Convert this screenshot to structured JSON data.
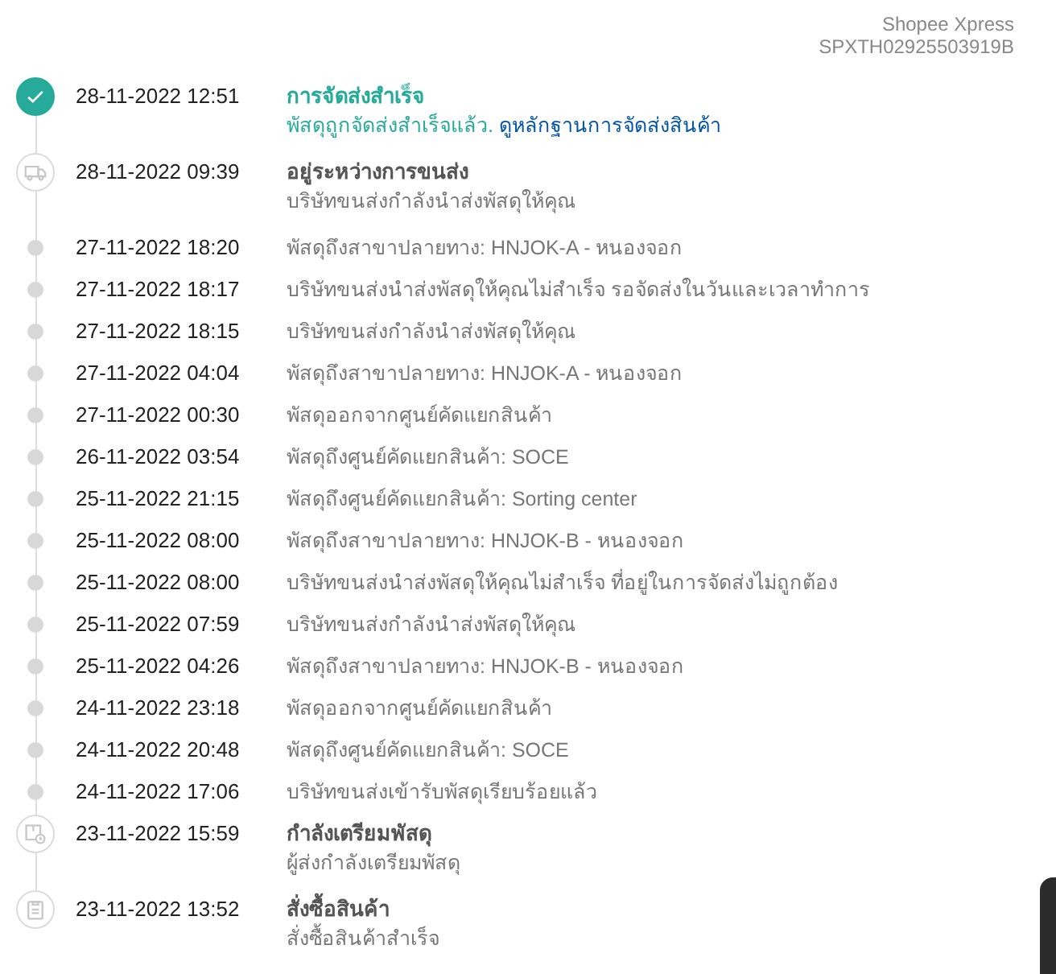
{
  "header": {
    "carrier": "Shopee Xpress",
    "tracking_number": "SPXTH02925503919B"
  },
  "events": [
    {
      "kind": "delivered",
      "active": true,
      "time": "28-11-2022 12:51",
      "title": "การจัดส่งสำเร็จ",
      "description": "พัสดุถูกจัดส่งสำเร็จแล้ว.",
      "link": "ดูหลักฐานการจัดส่งสินค้า"
    },
    {
      "kind": "shipping",
      "active": false,
      "time": "28-11-2022 09:39",
      "title": "อยู่ระหว่างการขนส่ง",
      "description": "บริษัทขนส่งกำลังนำส่งพัสดุให้คุณ"
    },
    {
      "kind": "minor",
      "time": "27-11-2022 18:20",
      "description": "พัสดุถึงสาขาปลายทาง: HNJOK-A - หนองจอก"
    },
    {
      "kind": "minor",
      "time": "27-11-2022 18:17",
      "description": "บริษัทขนส่งนำส่งพัสดุให้คุณไม่สำเร็จ รอจัดส่งในวันและเวลาทำการ"
    },
    {
      "kind": "minor",
      "time": "27-11-2022 18:15",
      "description": "บริษัทขนส่งกำลังนำส่งพัสดุให้คุณ"
    },
    {
      "kind": "minor",
      "time": "27-11-2022 04:04",
      "description": "พัสดุถึงสาขาปลายทาง: HNJOK-A - หนองจอก"
    },
    {
      "kind": "minor",
      "time": "27-11-2022 00:30",
      "description": "พัสดุออกจากศูนย์คัดแยกสินค้า"
    },
    {
      "kind": "minor",
      "time": "26-11-2022 03:54",
      "description": "พัสดุถึงศูนย์คัดแยกสินค้า: SOCE"
    },
    {
      "kind": "minor",
      "time": "25-11-2022 21:15",
      "description": "พัสดุถึงศูนย์คัดแยกสินค้า: Sorting center"
    },
    {
      "kind": "minor",
      "time": "25-11-2022 08:00",
      "description": "พัสดุถึงสาขาปลายทาง: HNJOK-B - หนองจอก"
    },
    {
      "kind": "minor",
      "time": "25-11-2022 08:00",
      "description": "บริษัทขนส่งนำส่งพัสดุให้คุณไม่สำเร็จ ที่อยู่ในการจัดส่งไม่ถูกต้อง"
    },
    {
      "kind": "minor",
      "time": "25-11-2022 07:59",
      "description": "บริษัทขนส่งกำลังนำส่งพัสดุให้คุณ"
    },
    {
      "kind": "minor",
      "time": "25-11-2022 04:26",
      "description": "พัสดุถึงสาขาปลายทาง: HNJOK-B - หนองจอก"
    },
    {
      "kind": "minor",
      "time": "24-11-2022 23:18",
      "description": "พัสดุออกจากศูนย์คัดแยกสินค้า"
    },
    {
      "kind": "minor",
      "time": "24-11-2022 20:48",
      "description": "พัสดุถึงศูนย์คัดแยกสินค้า: SOCE"
    },
    {
      "kind": "minor",
      "time": "24-11-2022 17:06",
      "description": "บริษัทขนส่งเข้ารับพัสดุเรียบร้อยแล้ว"
    },
    {
      "kind": "preparing",
      "active": false,
      "time": "23-11-2022 15:59",
      "title": "กำลังเตรียมพัสดุ",
      "description": "ผู้ส่งกำลังเตรียมพัสดุ"
    },
    {
      "kind": "ordered",
      "active": false,
      "time": "23-11-2022 13:52",
      "title": "สั่งซื้อสินค้า",
      "description": "สั่งซื้อสินค้าสำเร็จ"
    }
  ]
}
